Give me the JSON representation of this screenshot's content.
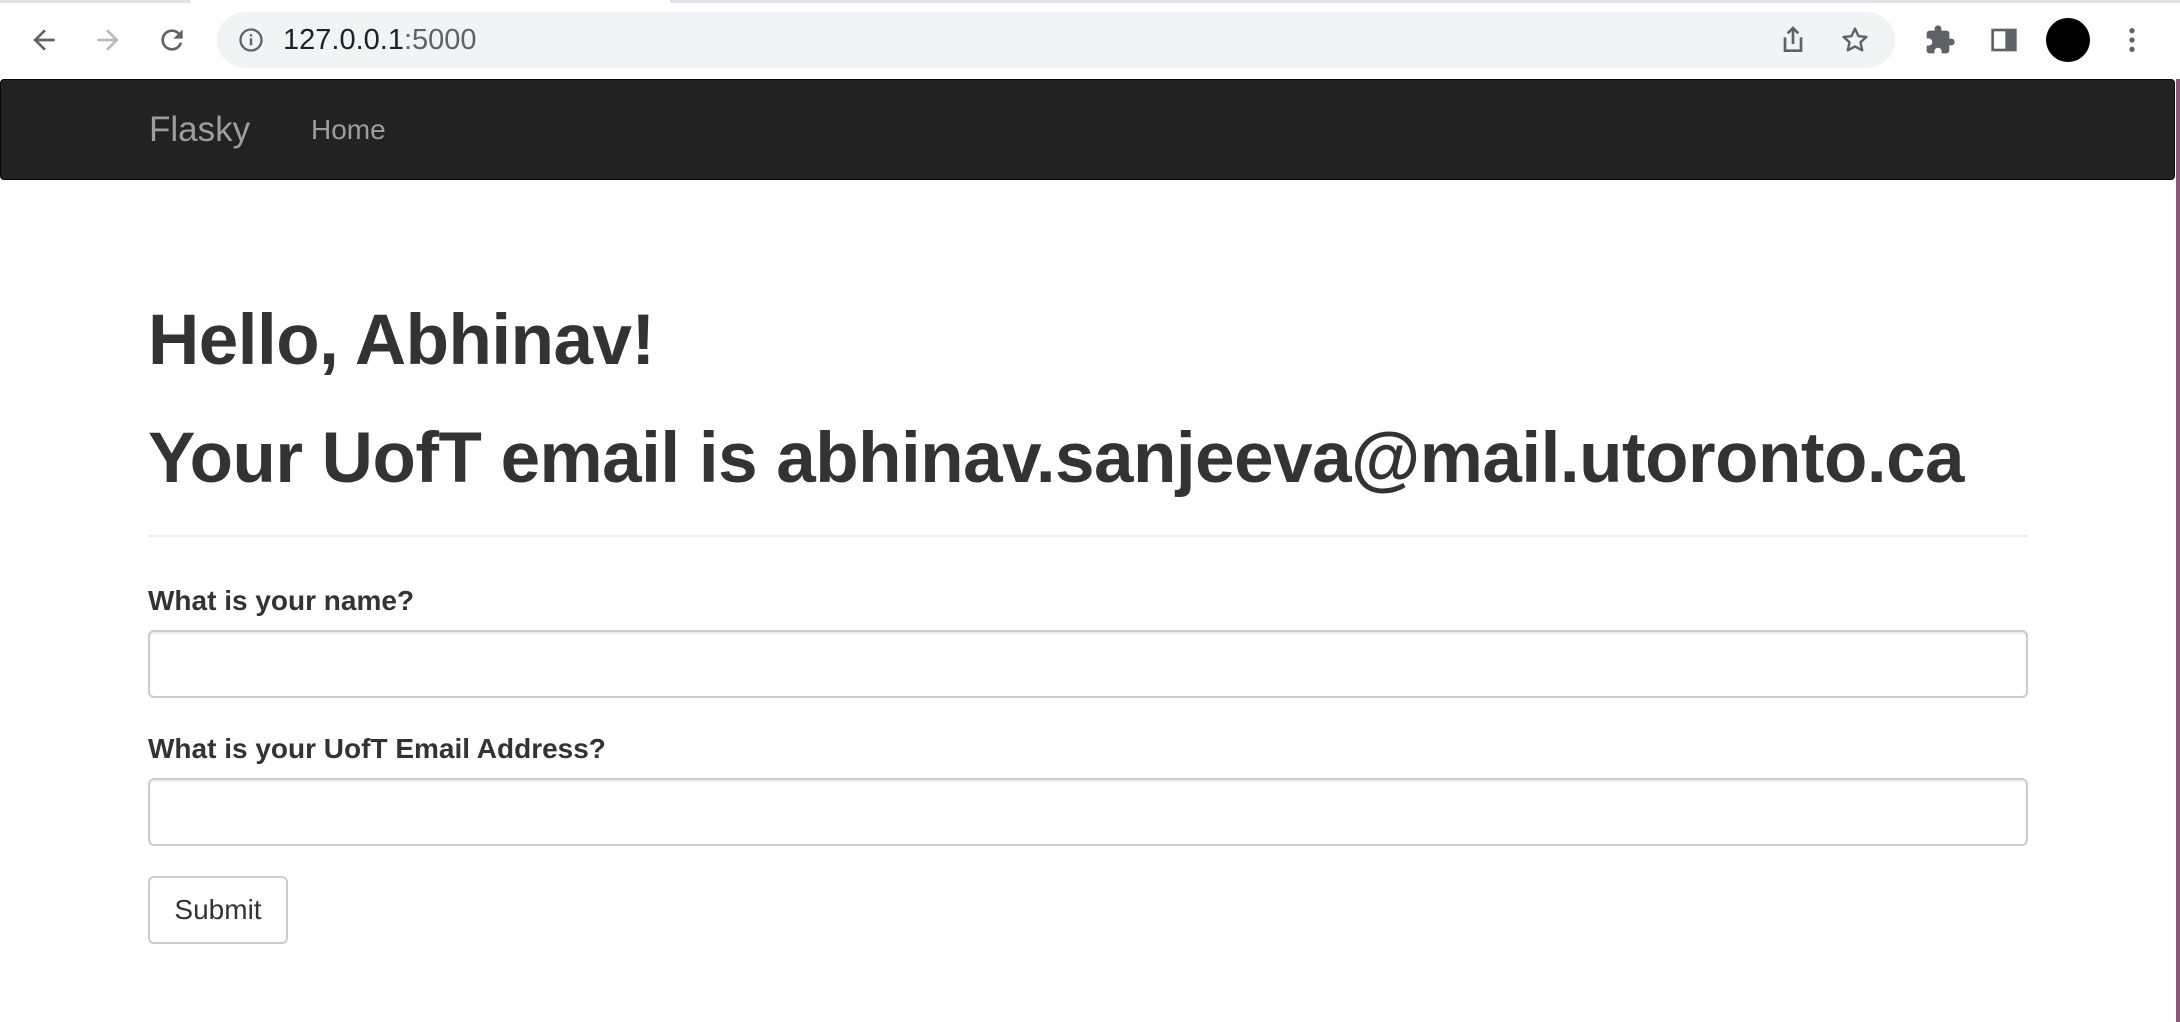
{
  "browser": {
    "url_host": "127.0.0.1",
    "url_port": ":5000",
    "icons": [
      "back-arrow-icon",
      "forward-arrow-icon",
      "reload-icon",
      "info-icon",
      "share-icon",
      "star-icon",
      "extensions-icon",
      "side-panel-icon",
      "profile-avatar",
      "more-menu-icon"
    ]
  },
  "navbar": {
    "brand": "Flasky",
    "links": [
      "Home"
    ]
  },
  "main": {
    "greeting": "Hello, Abhinav!",
    "email_line": "Your UofT email is abhinav.sanjeeva@mail.utoronto.ca",
    "form": {
      "name_label": "What is your name?",
      "name_value": "",
      "email_label": "What is your UofT Email Address?",
      "email_value": "",
      "submit_label": "Submit"
    }
  },
  "colors": {
    "navbar_bg": "#222222",
    "navbar_text": "#9d9d9d",
    "text": "#333333",
    "omnibox_bg": "#f1f3f4"
  }
}
